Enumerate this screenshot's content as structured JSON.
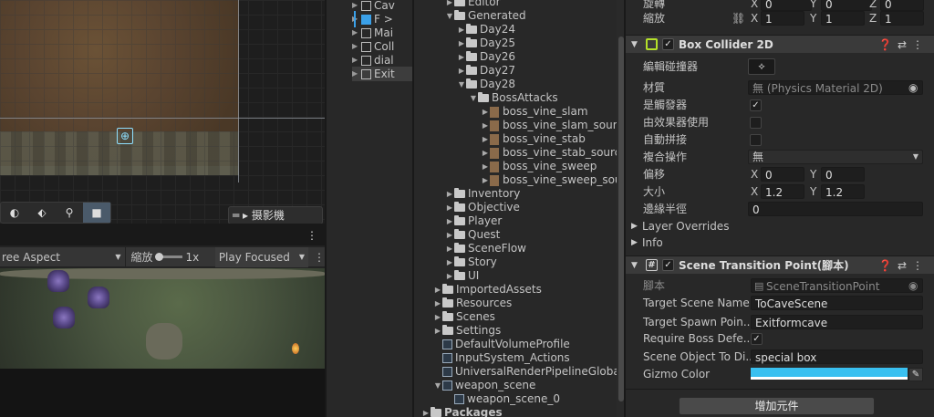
{
  "scene": {
    "camera_chip": "摄影機",
    "tools": [
      "orbit",
      "nodes",
      "search",
      "camera"
    ]
  },
  "game": {
    "aspect": "ree Aspect",
    "zoom_label": "縮放",
    "zoom_value": "1x",
    "play_mode": "Play Focused"
  },
  "hierarchy": {
    "items": [
      {
        "label": "Cav",
        "icon": "cube-icon"
      },
      {
        "label": "F >",
        "icon": "cube-blue-icon"
      },
      {
        "label": "Mai",
        "icon": "cube-icon"
      },
      {
        "label": "Coll",
        "icon": "cube-icon"
      },
      {
        "label": "dial",
        "icon": "cube-icon"
      },
      {
        "label": "Exit",
        "icon": "cube-icon",
        "selected": true
      }
    ]
  },
  "project": {
    "items": [
      {
        "label": "Editor",
        "depth": 3,
        "expanded": false
      },
      {
        "label": "Generated",
        "depth": 3,
        "expanded": true
      },
      {
        "label": "Day24",
        "depth": 4,
        "expanded": false
      },
      {
        "label": "Day25",
        "depth": 4,
        "expanded": false
      },
      {
        "label": "Day26",
        "depth": 4,
        "expanded": false
      },
      {
        "label": "Day27",
        "depth": 4,
        "expanded": false
      },
      {
        "label": "Day28",
        "depth": 4,
        "expanded": true
      },
      {
        "label": "BossAttacks",
        "depth": 5,
        "expanded": true
      },
      {
        "label": "boss_vine_slam",
        "depth": 6,
        "asset": true
      },
      {
        "label": "boss_vine_slam_source",
        "depth": 6,
        "asset": true
      },
      {
        "label": "boss_vine_stab",
        "depth": 6,
        "asset": true
      },
      {
        "label": "boss_vine_stab_source",
        "depth": 6,
        "asset": true
      },
      {
        "label": "boss_vine_sweep",
        "depth": 6,
        "asset": true
      },
      {
        "label": "boss_vine_sweep_source",
        "depth": 6,
        "asset": true
      },
      {
        "label": "Inventory",
        "depth": 3,
        "expanded": false
      },
      {
        "label": "Objective",
        "depth": 3,
        "expanded": false
      },
      {
        "label": "Player",
        "depth": 3,
        "expanded": false
      },
      {
        "label": "Quest",
        "depth": 3,
        "expanded": false
      },
      {
        "label": "SceneFlow",
        "depth": 3,
        "expanded": false
      },
      {
        "label": "Story",
        "depth": 3,
        "expanded": false
      },
      {
        "label": "UI",
        "depth": 3,
        "expanded": false
      },
      {
        "label": "ImportedAssets",
        "depth": 2,
        "expanded": false
      },
      {
        "label": "Resources",
        "depth": 2,
        "expanded": false
      },
      {
        "label": "Scenes",
        "depth": 2,
        "expanded": false
      },
      {
        "label": "Settings",
        "depth": 2,
        "expanded": false
      },
      {
        "label": "DefaultVolumeProfile",
        "depth": 2,
        "file": true
      },
      {
        "label": "InputSystem_Actions",
        "depth": 2,
        "file": true
      },
      {
        "label": "UniversalRenderPipelineGlobalSe",
        "depth": 2,
        "file": true
      },
      {
        "label": "weapon_scene",
        "depth": 2,
        "expanded": true,
        "file": true
      },
      {
        "label": "weapon_scene_0",
        "depth": 3,
        "file": true
      },
      {
        "label": "Packages",
        "depth": 1,
        "expanded": false
      }
    ]
  },
  "inspector": {
    "rotation_label": "旋轉",
    "scale_label": "縮放",
    "scale": {
      "x": "1",
      "y": "1",
      "z": "1"
    },
    "rotation": {
      "x": "0",
      "y": "0",
      "z": "0"
    },
    "box_collider": {
      "title": "Box Collider 2D",
      "edit_label": "編輯碰撞器",
      "material_label": "材質",
      "material_value": "無 (Physics Material 2D)",
      "trigger_label": "是觸發器",
      "effector_label": "由效果器使用",
      "autotile_label": "自動拼接",
      "composite_label": "複合操作",
      "composite_value": "無",
      "offset_label": "偏移",
      "offset": {
        "x": "0",
        "y": "0"
      },
      "size_label": "大小",
      "size": {
        "x": "1.2",
        "y": "1.2"
      },
      "edge_label": "邊緣半徑",
      "edge_value": "0",
      "layer_overrides": "Layer Overrides",
      "info": "Info"
    },
    "scene_transition": {
      "title": "Scene Transition Point(腳本)",
      "script_label": "腳本",
      "script_value": "SceneTransitionPoint",
      "target_scene_label": "Target Scene Name",
      "target_scene_value": "ToCaveScene",
      "spawn_label": "Target Spawn Poin...",
      "spawn_value": "Exitformcave",
      "boss_label": "Require Boss Defe...",
      "scene_object_label": "Scene Object To Di...",
      "scene_object_value": "special box",
      "gizmo_label": "Gizmo Color",
      "gizmo_color": "#39c0f0"
    },
    "add_component": "增加元件"
  }
}
